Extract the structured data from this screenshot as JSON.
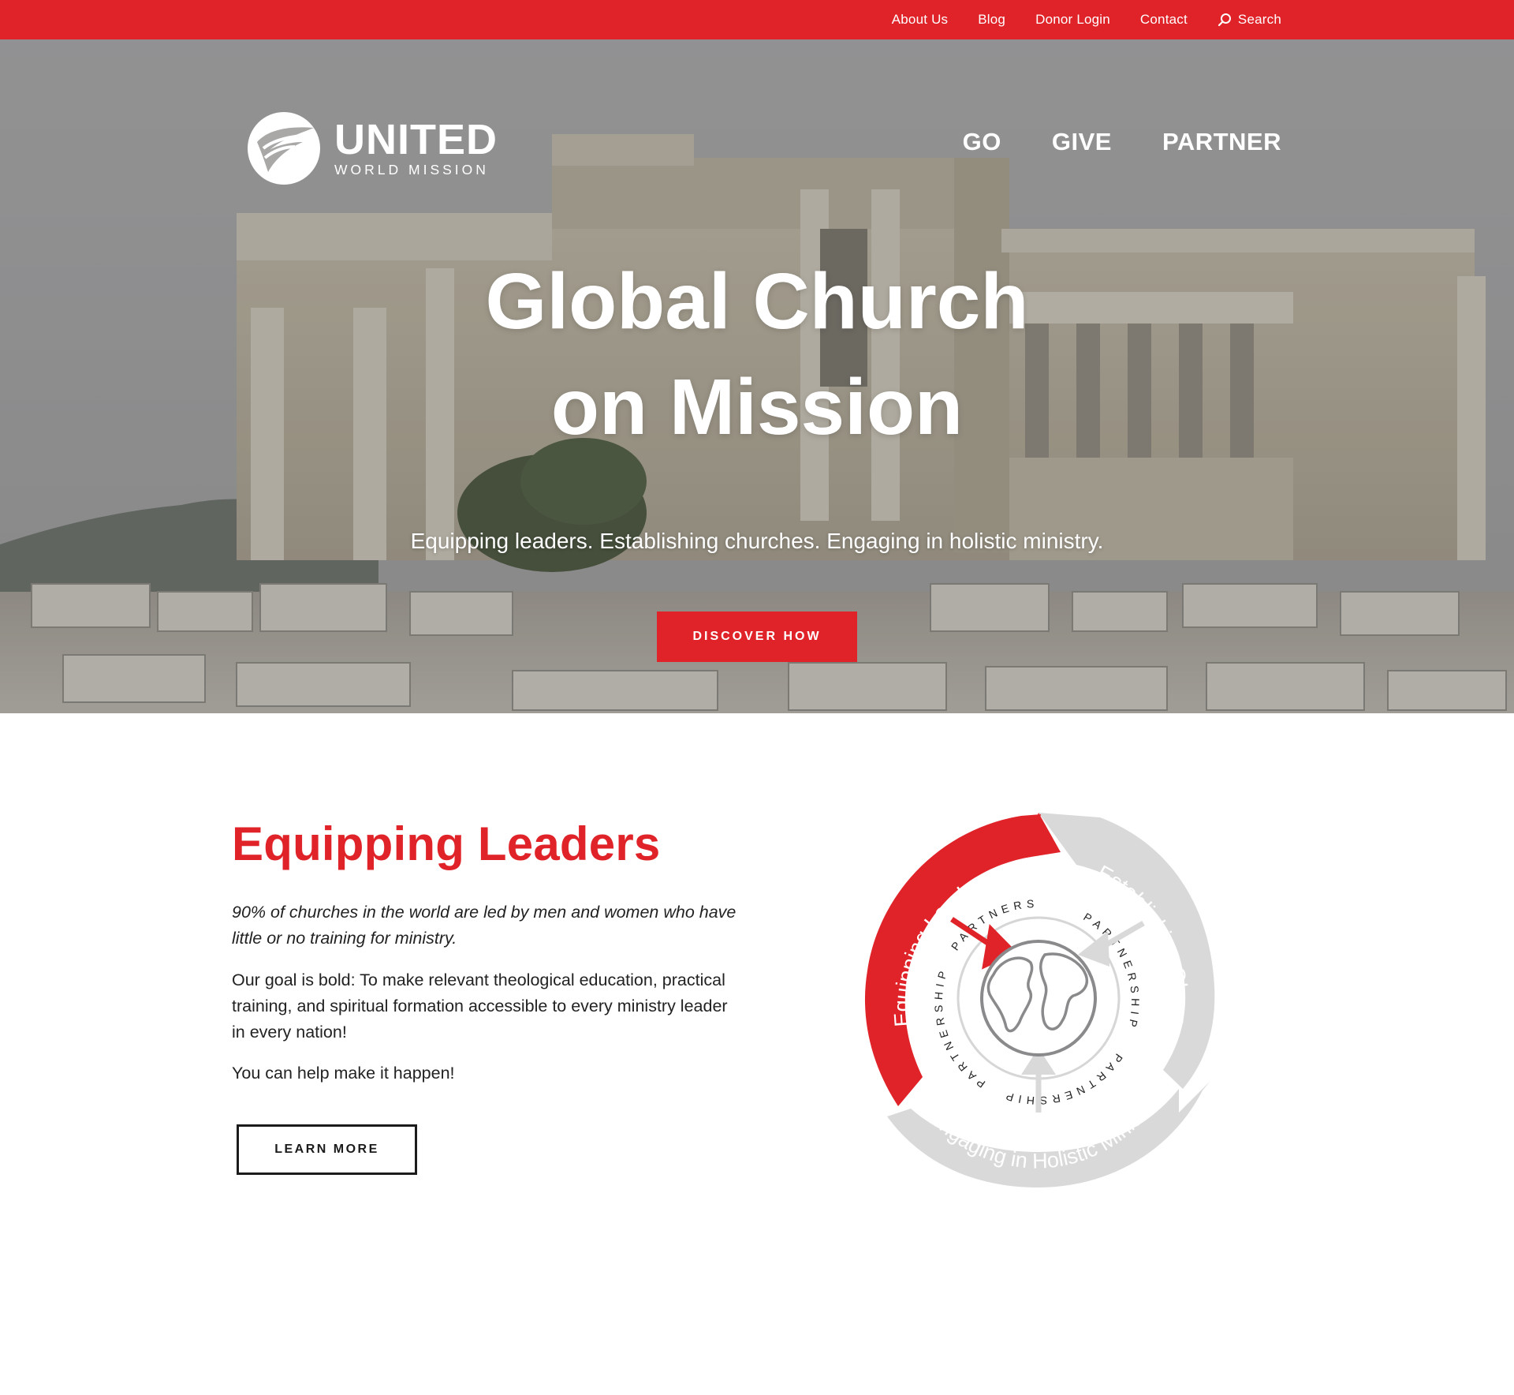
{
  "topbar": {
    "links": [
      "About Us",
      "Blog",
      "Donor Login",
      "Contact"
    ],
    "search_label": "Search",
    "background": "#e02329"
  },
  "logo": {
    "brand": "UNITED",
    "subtitle": "WORLD MISSION"
  },
  "mainnav": [
    "GO",
    "GIVE",
    "PARTNER"
  ],
  "hero": {
    "title_line1": "Global Church",
    "title_line2": "on Mission",
    "subtitle": "Equipping leaders. Establishing churches. Engaging in holistic ministry.",
    "cta_label": "DISCOVER HOW"
  },
  "section": {
    "title": "Equipping Leaders",
    "lede": "90% of churches in the world are led by men and women who have little or no training for ministry.",
    "paragraph1": "Our goal is bold: To make relevant theological education, practical training, and spiritual formation accessible to every ministry leader in every nation!",
    "paragraph2": "You can help make it happen!",
    "cta_label": "LEARN MORE"
  },
  "cycle": {
    "arc_labels": [
      "Equipping Leaders",
      "Establishing Churches",
      "Engaging in Holistic Ministry"
    ],
    "ring_word": "PARTNERSHIP",
    "active_color": "#e02329",
    "inactive_color": "#d9d9da"
  },
  "icons": [
    "search-icon",
    "united-logo-mark",
    "globe-icon"
  ]
}
